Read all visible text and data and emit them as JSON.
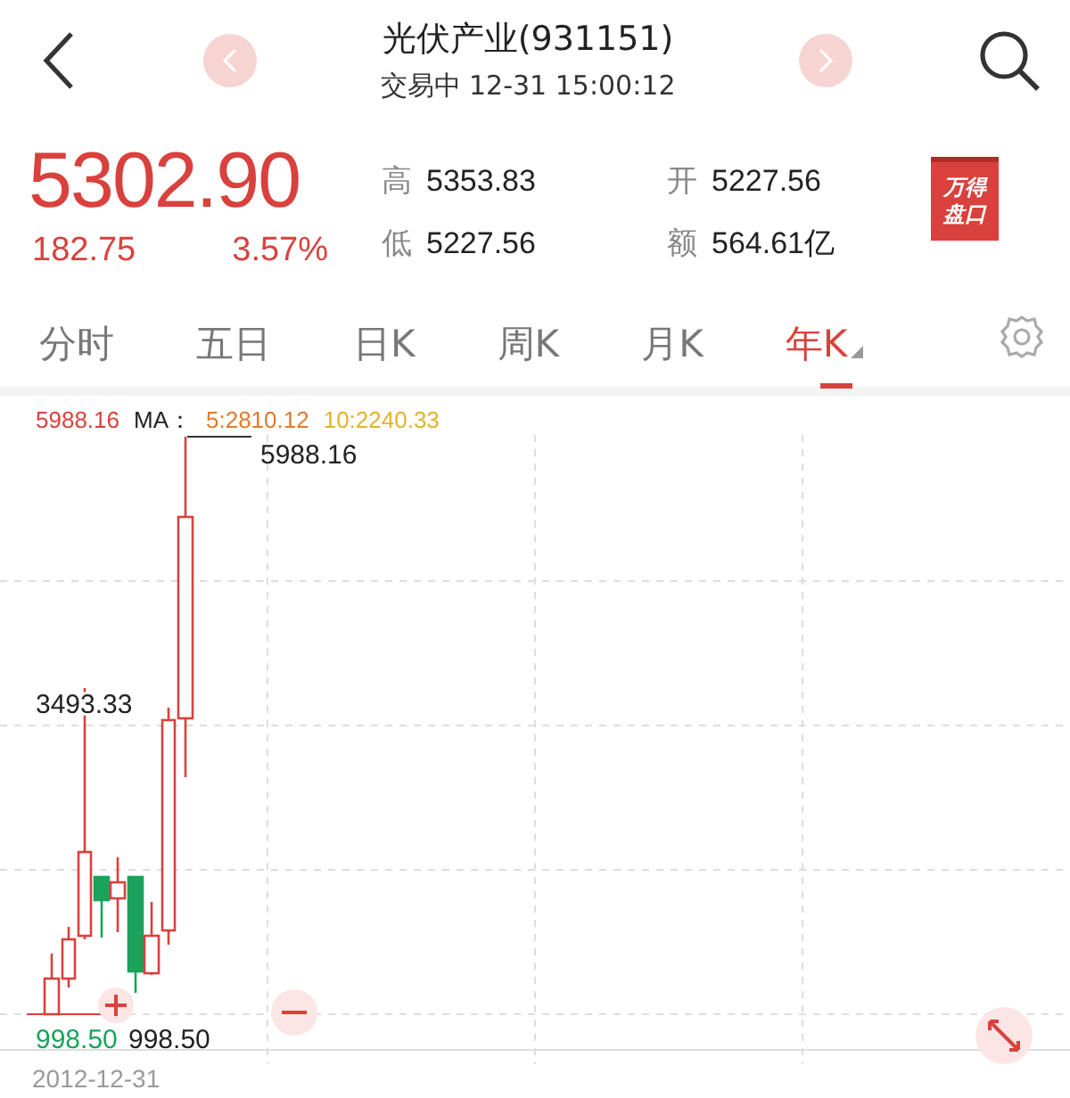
{
  "header": {
    "title": "光伏产业(931151)",
    "subtitle": "交易中 12-31 15:00:12"
  },
  "quote": {
    "price": "5302.90",
    "change": "182.75",
    "change_pct": "3.57%",
    "stats": [
      {
        "label": "高",
        "value": "5353.83"
      },
      {
        "label": "开",
        "value": "5227.56"
      },
      {
        "label": "低",
        "value": "5227.56"
      },
      {
        "label": "额",
        "value": "564.61亿"
      }
    ],
    "badge": [
      "万得",
      "盘口"
    ]
  },
  "tabs": [
    {
      "label": "分时",
      "selected": false,
      "has_menu": false
    },
    {
      "label": "五日",
      "selected": false,
      "has_menu": false
    },
    {
      "label": "日K",
      "selected": false,
      "has_menu": false
    },
    {
      "label": "周K",
      "selected": false,
      "has_menu": false
    },
    {
      "label": "月K",
      "selected": false,
      "has_menu": false
    },
    {
      "label": "年K",
      "selected": true,
      "has_menu": true
    }
  ],
  "chart": {
    "max_value": "5988.16",
    "ma_title": "MA：",
    "ma5": "5:2810.12",
    "ma10": "10:2240.33",
    "high_label": "5988.16",
    "mid_label": "3493.33",
    "low_labels": [
      "998.50",
      "998.50"
    ],
    "date": "2012-12-31"
  }
}
